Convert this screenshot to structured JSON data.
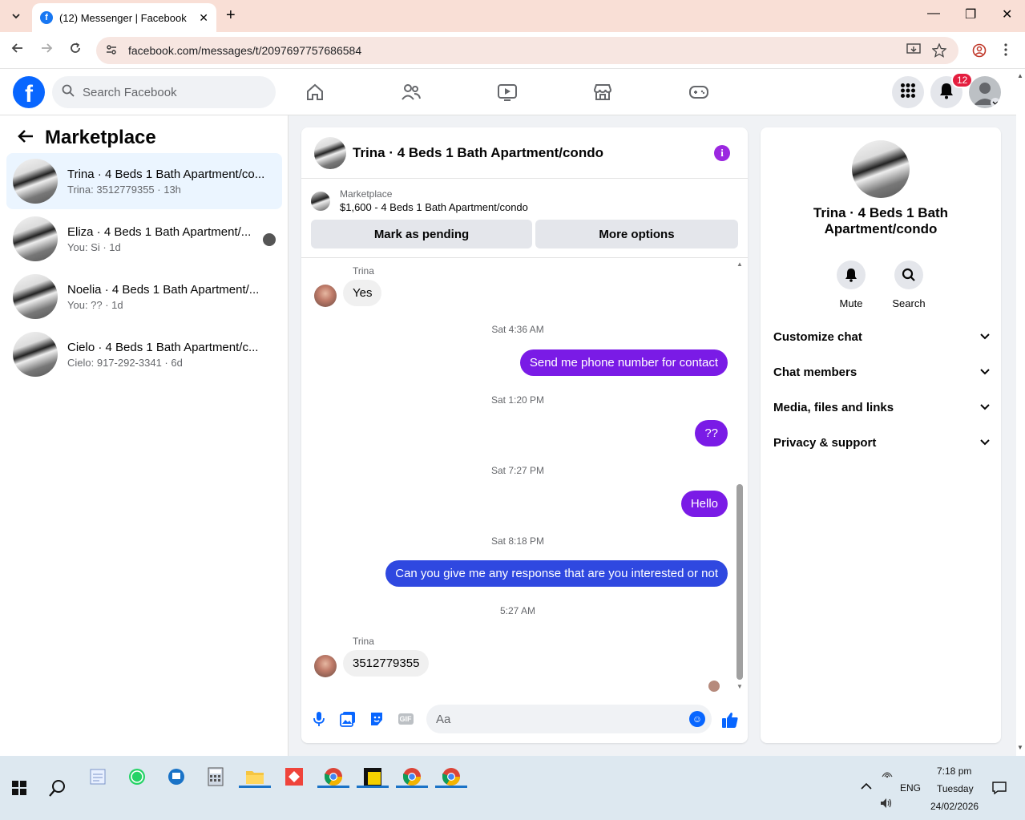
{
  "browser": {
    "tab_title": "(12) Messenger | Facebook",
    "tab_badge": "f",
    "url": "facebook.com/messages/t/2097697757686584",
    "new_tab": "+",
    "tab_close": "✕",
    "minimize": "—",
    "maximize": "❐",
    "close": "✕"
  },
  "facebook": {
    "search_placeholder": "Search Facebook",
    "notifications_count": "12",
    "logo_letter": "f"
  },
  "left_panel": {
    "title": "Marketplace",
    "conversations": [
      {
        "name": "Trina · 4 Beds 1 Bath Apartment/co...",
        "preview": "Trina: 3512779355 · 13h"
      },
      {
        "name": "Eliza · 4 Beds 1 Bath Apartment/...",
        "preview": "You: Si · 1d"
      },
      {
        "name": "Noelia · 4 Beds 1 Bath Apartment/...",
        "preview": "You: ?? · 1d"
      },
      {
        "name": "Cielo · 4 Beds 1 Bath Apartment/c...",
        "preview": "Cielo: 917-292-3341 · 6d"
      }
    ]
  },
  "chat": {
    "header_name": "Trina · 4 Beds 1 Bath Apartment/condo",
    "info_glyph": "i",
    "marketplace_label": "Marketplace",
    "listing": "$1,600 - 4 Beds 1 Bath Apartment/condo",
    "mark_pending": "Mark as pending",
    "more_options": "More options",
    "messages": {
      "sender1": "Trina",
      "m1": "Yes",
      "ts1": "Sat 4:36 AM",
      "m2": "Send me phone number for contact",
      "ts2": "Sat 1:20 PM",
      "m3": "??",
      "ts3": "Sat 7:27 PM",
      "m4": "Hello",
      "ts4": "Sat 8:18 PM",
      "m5": "Can you give me any response that are you interested or not",
      "ts5": "5:27 AM",
      "sender2": "Trina",
      "m6": "3512779355"
    },
    "composer_placeholder": "Aa",
    "emoji_glyph": "☺",
    "gif_label": "GIF"
  },
  "right_panel": {
    "name": "Trina · 4 Beds 1 Bath Apartment/condo",
    "mute": "Mute",
    "search": "Search",
    "sections": [
      "Customize chat",
      "Chat members",
      "Media, files and links",
      "Privacy & support"
    ]
  },
  "taskbar": {
    "time": "7:18 pm",
    "day": "Tuesday",
    "date": "24/02/2026",
    "lang": "ENG"
  },
  "colors": {
    "accent_purple": "#7a1be6",
    "fb_blue": "#0866ff",
    "active_row": "#ebf5ff"
  }
}
